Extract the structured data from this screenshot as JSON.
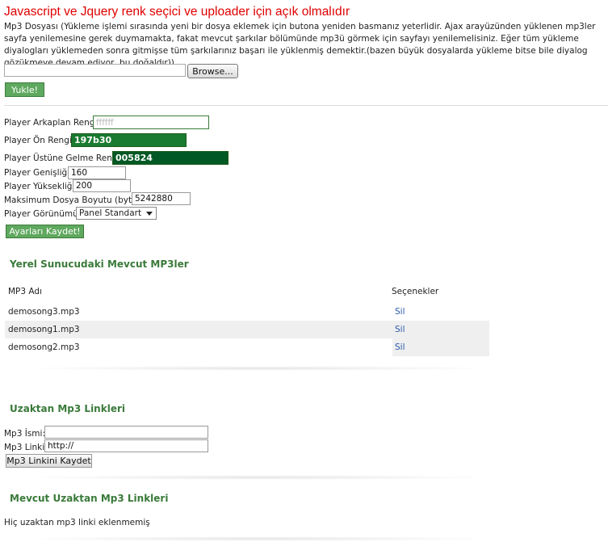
{
  "warning": "Javascript ve Jquery renk seçici ve uploader için açık olmalıdır",
  "upload": {
    "description": "Mp3 Dosyası (Yükleme işlemi sırasında yeni bir dosya eklemek için butona yeniden basmanız yeterlidir. Ajax arayüzünden yüklenen mp3ler sayfa yenilemesine gerek duymamakta, fakat mevcut şarkılar bölümünde mp3ü görmek için sayfayı yenilemelisiniz. Eğer tüm yükleme diyalogları yüklemeden sonra gitmişse tüm şarkılarınız başarı ile yüklenmiş demektir.(bazen büyük dosyalarda yükleme bitse bile diyalog gözükmeye devam ediyor, bu doğaldır))",
    "browse_label": "Browse...",
    "upload_label": "Yukle!"
  },
  "settings": {
    "bg_color_label": "Player Arkaplan Rengi:",
    "bg_color_value": "ffffff",
    "fg_color_label": "Player Ön Rengi:",
    "fg_color_value": "197b30",
    "hover_color_label": "Player Üstüne Gelme Rengi:",
    "hover_color_value": "005824",
    "width_label": "Player Genişliği:",
    "width_value": "160",
    "height_label": "Player Yüksekliği:",
    "height_value": "200",
    "maxsize_label": "Maksimum Dosya Boyutu (byte):",
    "maxsize_value": "5242880",
    "view_label": "Player Görünümü:",
    "view_value": "Panel Standart",
    "save_label": "Ayarları Kaydet!",
    "colors": {
      "fg": "#197b30",
      "hover": "#005824"
    }
  },
  "local": {
    "title": "Yerel Sunucudaki Mevcut MP3ler",
    "col_name": "MP3 Adı",
    "col_options": "Seçenekler",
    "rows": [
      {
        "name": "demosong3.mp3",
        "action": "Sil"
      },
      {
        "name": "demosong1.mp3",
        "action": "Sil"
      },
      {
        "name": "demosong2.mp3",
        "action": "Sil"
      }
    ]
  },
  "remote": {
    "title": "Uzaktan Mp3 Linkleri",
    "name_label": "Mp3 İsmi:",
    "name_value": "",
    "link_label": "Mp3 Linki:",
    "link_value": "http://",
    "save_label": "Mp3 Linkini Kaydet"
  },
  "existing_remote": {
    "title": "Mevcut Uzaktan Mp3 Linkleri",
    "empty_text": "Hiç uzaktan mp3 linki eklenmemiş"
  }
}
